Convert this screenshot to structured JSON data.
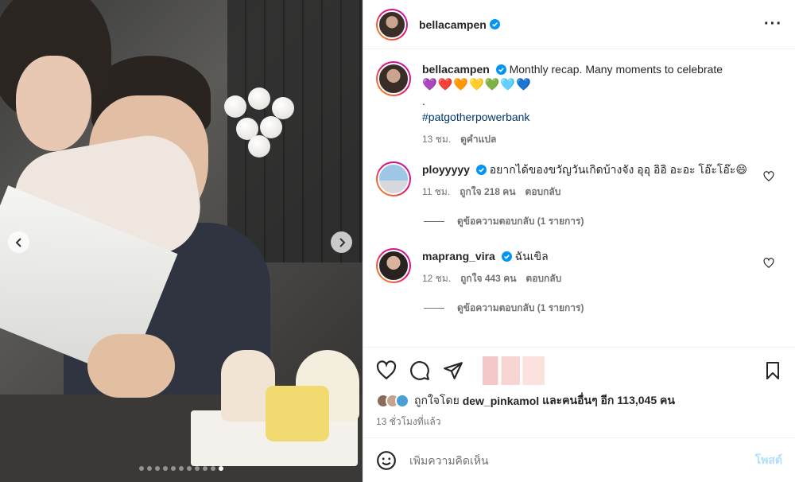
{
  "post": {
    "author": "bellacampen",
    "caption": "Monthly recap. Many moments to celebrate",
    "caption_emojis": "💜❤️🧡💛💚🩵💙",
    "caption_dot": ".",
    "hashtag": "#patgotherpowerbank",
    "time": "13 ชม.",
    "translate": "ดูคำแปล"
  },
  "comments": [
    {
      "username": "ployyyyy",
      "text": "อยากได้ของขวัญวันเกิดบ้างจัง อุอุ อิอิ อะอะ โอ๊ะโอ๊ะ😄",
      "time": "11 ชม.",
      "likes": "ถูกใจ 218 คน",
      "reply": "ตอบกลับ",
      "view_replies": "ดูข้อความตอบกลับ (1 รายการ)"
    },
    {
      "username": "maprang_vira",
      "text": "ฉันเขิล",
      "time": "12 ชม.",
      "likes": "ถูกใจ 443 คน",
      "reply": "ตอบกลับ",
      "view_replies": "ดูข้อความตอบกลับ (1 รายการ)"
    }
  ],
  "likes": {
    "prefix": "ถูกใจโดย",
    "user": "dew_pinkamol",
    "suffix": "และคนอื่นๆ อีก 113,045 คน"
  },
  "posted_ago": "13 ชั่วโมงที่แล้ว",
  "composer": {
    "placeholder": "เพิ่มความคิดเห็น",
    "post_label": "โพสต์"
  },
  "carousel": {
    "total": 11,
    "active": 10
  },
  "colors": {
    "verified": "#0095f6",
    "link": "#00376b",
    "muted": "#737373"
  }
}
